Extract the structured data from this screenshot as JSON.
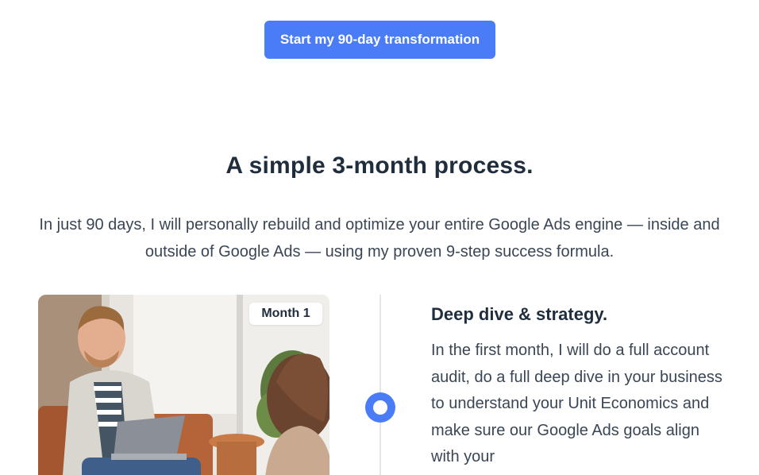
{
  "cta": {
    "label": "Start my 90-day transformation"
  },
  "process": {
    "title": "A simple 3-month process.",
    "intro": "In just 90 days, I will personally rebuild and optimize your entire Google Ads engine — inside and outside of Google Ads — using my proven 9-step success formula."
  },
  "steps": [
    {
      "badge": "Month 1",
      "title": "Deep dive & strategy.",
      "body": "In the first month, I will do a full account audit, do a full deep dive in your business to understand your Unit Economics and make sure our Google Ads goals align with your"
    }
  ],
  "colors": {
    "accent": "#4a7cf7",
    "heading": "#1f2d3d",
    "body_text": "#3a4655",
    "timeline_line": "#e3e6ea"
  }
}
